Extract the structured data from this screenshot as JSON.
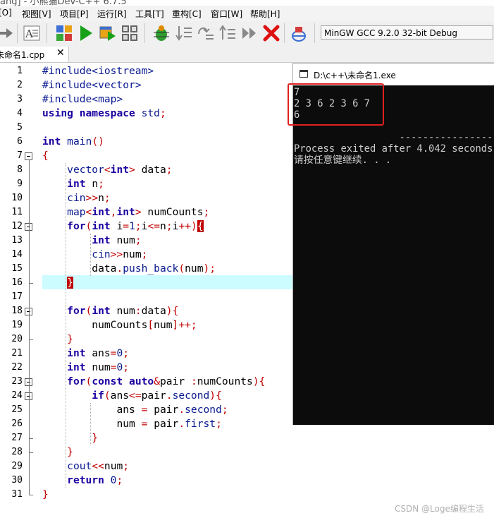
{
  "window": {
    "title_partial": "ang] - 小熊猫Dev-C++ 6.7.5"
  },
  "menu": [
    "[O]",
    "视图[V]",
    "项目[P]",
    "运行[R]",
    "工具[T]",
    "重构[C]",
    "窗口[W]",
    "帮助[H]"
  ],
  "toolbar": {
    "icons": [
      "arrow-right-icon",
      "format-code-icon",
      "compile-icon",
      "run-icon",
      "compile-run-icon",
      "rebuild-icon",
      "debug-icon",
      "step-into-icon",
      "step-over-icon",
      "step-out-icon",
      "continue-icon",
      "stop-icon",
      "profile-icon"
    ],
    "compiler": "MinGW GCC 9.2.0 32-bit Debug"
  },
  "tab": {
    "label": "未命名1.cpp",
    "close": "✕"
  },
  "editor": {
    "line_numbers": [
      "1",
      "2",
      "3",
      "4",
      "5",
      "6",
      "7",
      "8",
      "9",
      "10",
      "11",
      "12",
      "13",
      "14",
      "15",
      "16",
      "17",
      "18",
      "19",
      "20",
      "21",
      "22",
      "23",
      "24",
      "25",
      "26",
      "27",
      "28",
      "29",
      "30",
      "31"
    ],
    "active_line": 16,
    "code": [
      "#include<iostream>",
      "#include<vector>",
      "#include<map>",
      "using namespace std;",
      "",
      "int main()",
      "{",
      "    vector<int> data;",
      "    int n;",
      "    cin>>n;",
      "    map<int,int> numCounts;",
      "    for(int i=1;i<=n;i++){",
      "        int num;",
      "        cin>>num;",
      "        data.push_back(num);",
      "    }",
      "",
      "    for(int num:data){",
      "        numCounts[num]++;",
      "    }",
      "    int ans=0;",
      "    int num=0;",
      "    for(const auto&pair :numCounts){",
      "        if(ans<=pair.second){",
      "            ans = pair.second;",
      "            num = pair.first;",
      "        }",
      "    }",
      "    cout<<num;",
      "    return 0;",
      "}"
    ]
  },
  "console": {
    "title": "D:\\c++\\未命名1.exe",
    "lines": [
      "7",
      "2 3 6 2 3 6 7",
      "6",
      "",
      "                  ----------------",
      "Process exited after 4.042 seconds w",
      "请按任意键继续. . ."
    ]
  },
  "watermark": "CSDN @Loge编程生活",
  "colors": {
    "highlight": "#ccfcff",
    "keyword": "#1a00a0",
    "operator": "#c00000",
    "annotation_box": "#e02020",
    "console_bg": "#0c0c0c"
  }
}
